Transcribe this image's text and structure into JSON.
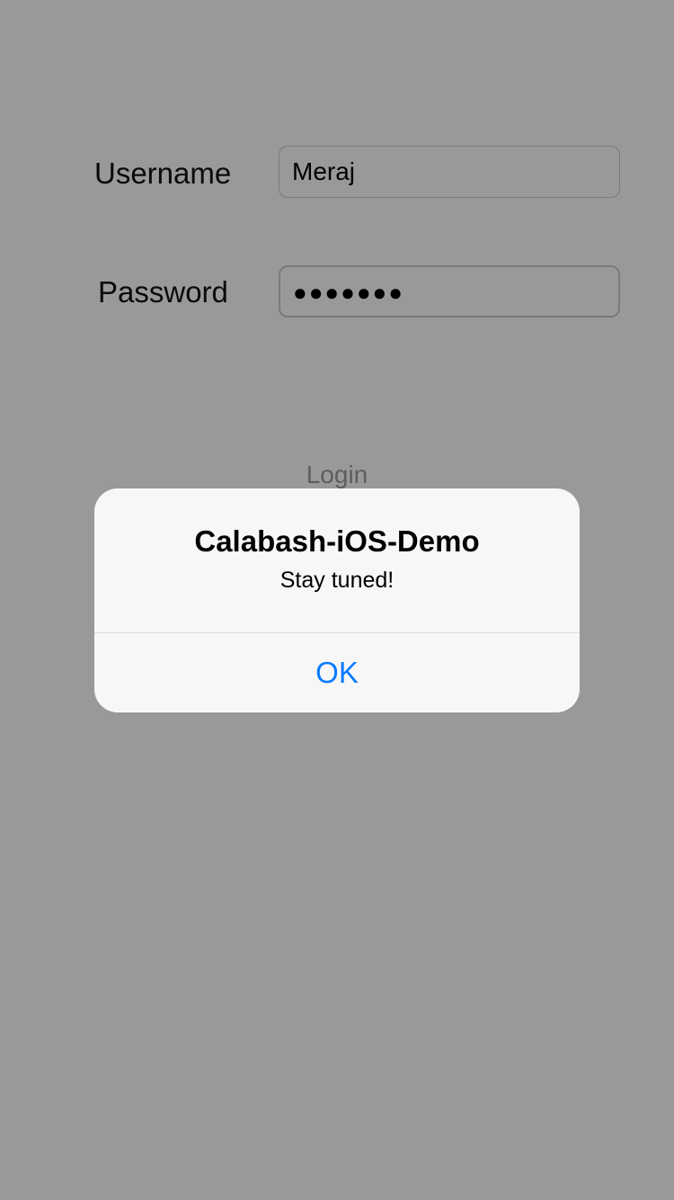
{
  "form": {
    "username_label": "Username",
    "username_value": "Meraj",
    "password_label": "Password",
    "password_value": "●●●●●●●",
    "login_label": "Login"
  },
  "alert": {
    "title": "Calabash-iOS-Demo",
    "message": "Stay tuned!",
    "ok_label": "OK"
  },
  "colors": {
    "accent": "#0a7aff",
    "overlay": "#999999"
  }
}
